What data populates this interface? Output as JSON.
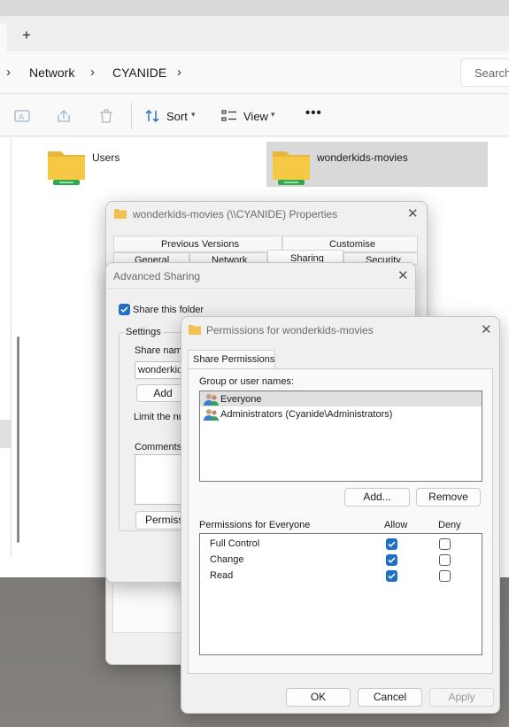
{
  "explorer": {
    "new_tab_glyph": "+",
    "breadcrumb": [
      "Network",
      "CYANIDE"
    ],
    "search_placeholder": "Search",
    "toolbar": {
      "sort_label": "Sort",
      "view_label": "View",
      "more_glyph": "•••"
    },
    "folders": [
      {
        "name": "Users"
      },
      {
        "name": "wonderkids-movies"
      }
    ]
  },
  "properties_dialog": {
    "title": "wonderkids-movies (\\\\CYANIDE) Properties",
    "tabs_row1": [
      "Previous Versions",
      "Customise"
    ],
    "tabs_row2": [
      "General",
      "Network",
      "Sharing",
      "Security"
    ]
  },
  "advanced_sharing": {
    "title": "Advanced Sharing",
    "share_checkbox_label": "Share this folder",
    "settings_label": "Settings",
    "share_name_label": "Share nam",
    "share_name_value": "wonderkids",
    "add_button": "Add",
    "limit_label": "Limit the nu",
    "comments_label": "Comments:",
    "permissions_button": "Permissi"
  },
  "permissions_dialog": {
    "title": "Permissions for wonderkids-movies",
    "tab": "Share Permissions",
    "group_label": "Group or user names:",
    "users": [
      "Everyone",
      "Administrators (Cyanide\\Administrators)"
    ],
    "add_button": "Add...",
    "remove_button": "Remove",
    "perms_header": "Permissions for Everyone",
    "allow_header": "Allow",
    "deny_header": "Deny",
    "permissions": [
      {
        "name": "Full Control",
        "allow": true,
        "deny": false
      },
      {
        "name": "Change",
        "allow": true,
        "deny": false
      },
      {
        "name": "Read",
        "allow": true,
        "deny": false
      }
    ],
    "ok_button": "OK",
    "cancel_button": "Cancel",
    "apply_button": "Apply"
  },
  "colors": {
    "accent": "#1f6fc5",
    "folder": "#f6c944",
    "selection": "#d9d9d9"
  }
}
